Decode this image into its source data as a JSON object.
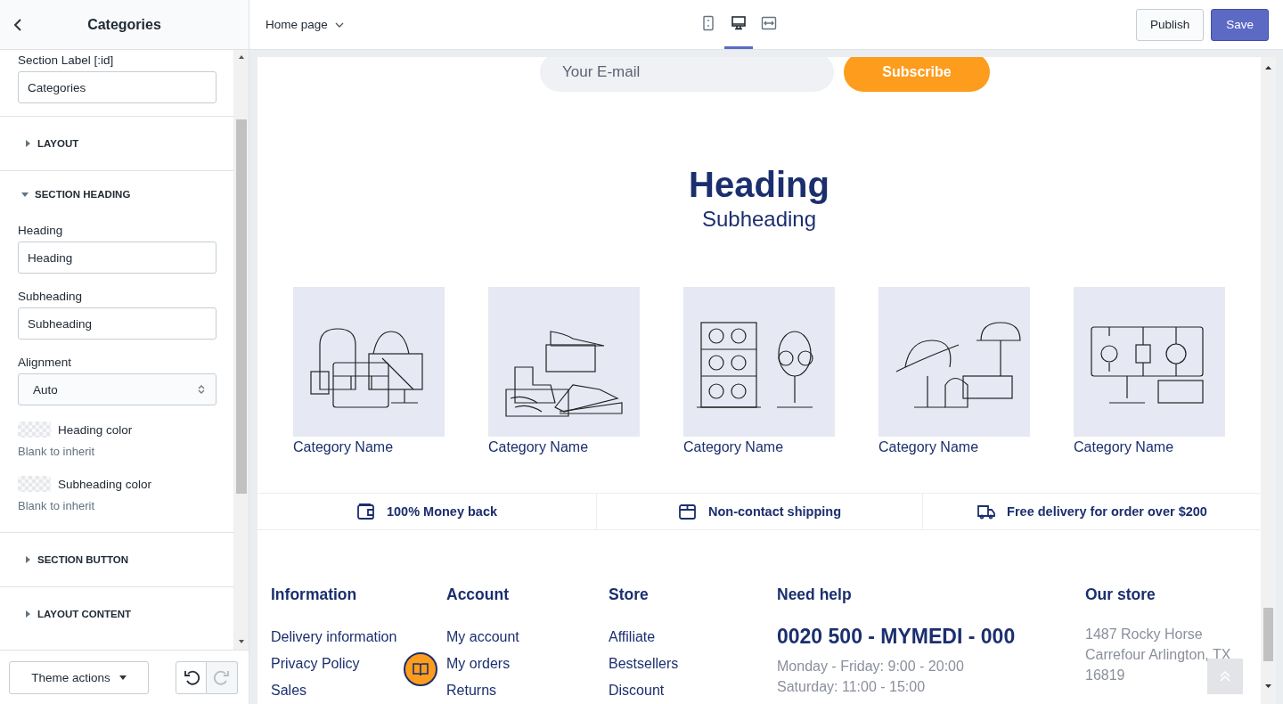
{
  "sidebar": {
    "title": "Categories",
    "items": [
      {
        "kind": "field",
        "label": "Section Label [:id]",
        "value": "Categories"
      },
      {
        "kind": "section",
        "label": "LAYOUT",
        "expanded": false
      },
      {
        "kind": "section",
        "label": "SECTION HEADING",
        "expanded": true
      },
      {
        "kind": "field",
        "label": "Heading",
        "value": "Heading"
      },
      {
        "kind": "field",
        "label": "Subheading",
        "value": "Subheading"
      },
      {
        "kind": "select",
        "label": "Alignment",
        "value": "Auto"
      },
      {
        "kind": "color",
        "label": "Heading color",
        "hint": "Blank to inherit"
      },
      {
        "kind": "color",
        "label": "Subheading color",
        "hint": "Blank to inherit"
      },
      {
        "kind": "section",
        "label": "SECTION BUTTON",
        "expanded": false
      },
      {
        "kind": "section",
        "label": "LAYOUT CONTENT",
        "expanded": false
      }
    ],
    "theme_actions": "Theme actions",
    "undo": {
      "disabled": false
    },
    "redo": {
      "disabled": true
    }
  },
  "topbar": {
    "page": "Home page",
    "device_tabs": [
      {
        "selected": false
      },
      {
        "selected": true
      },
      {
        "selected": false
      }
    ],
    "publish": "Publish",
    "save": "Save"
  },
  "preview": {
    "email_placeholder": "Your E-mail",
    "subscribe": "Subscribe",
    "heading": "Heading",
    "subheading": "Subheading",
    "categories": [
      {
        "name": "Category Name"
      },
      {
        "name": "Category Name"
      },
      {
        "name": "Category Name"
      },
      {
        "name": "Category Name"
      },
      {
        "name": "Category Name"
      }
    ],
    "features": [
      {
        "label": "100% Money back"
      },
      {
        "label": "Non-contact shipping"
      },
      {
        "label": "Free delivery for order over $200"
      }
    ],
    "footer": [
      {
        "kind": "links",
        "title": "Information",
        "lines": [
          "Delivery information",
          "Privacy Policy",
          "Sales"
        ]
      },
      {
        "kind": "links",
        "title": "Account",
        "lines": [
          "My account",
          "My orders",
          "Returns"
        ]
      },
      {
        "kind": "links",
        "title": "Store",
        "lines": [
          "Affiliate",
          "Bestsellers",
          "Discount"
        ]
      },
      {
        "kind": "contact",
        "title": "Need help",
        "phone": "0020 500 - MYMEDI - 000",
        "lines": [
          "Monday - Friday: 9:00 - 20:00",
          "Saturday: 11:00 - 15:00"
        ]
      },
      {
        "kind": "address",
        "title": "Our store",
        "lines": [
          "1487 Rocky Horse",
          "Carrefour Arlington, TX",
          "16819"
        ]
      }
    ]
  }
}
